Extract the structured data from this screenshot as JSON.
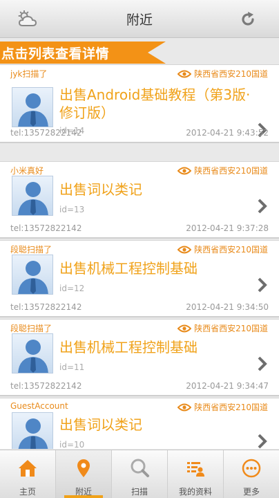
{
  "header": {
    "title": "附近",
    "left_icon": "weather-cloud-icon",
    "right_icon": "refresh-icon"
  },
  "banner": {
    "text": "点击列表查看详情"
  },
  "items": [
    {
      "user": "jyk扫描了",
      "location": "陕西省西安210国道",
      "title": "出售Android基础教程（第3版·修订版）",
      "id": "id=14",
      "tel": "tel:13572822142",
      "time": "2012-04-21 9:43:52"
    },
    {
      "user": "小米真好",
      "location": "陕西省西安210国道",
      "title": "出售词以类记",
      "id": "id=13",
      "tel": "tel:13572822142",
      "time": "2012-04-21 9:37:28"
    },
    {
      "user": "段聪扫描了",
      "location": "陕西省西安210国道",
      "title": "出售机械工程控制基础",
      "id": "id=12",
      "tel": "tel:13572822142",
      "time": "2012-04-21 9:34:50"
    },
    {
      "user": "段聪扫描了",
      "location": "陕西省西安210国道",
      "title": "出售机械工程控制基础",
      "id": "id=11",
      "tel": "tel:13572822142",
      "time": "2012-04-21 9:34:47"
    },
    {
      "user": "GuestAccount",
      "location": "陕西省西安210国道",
      "title": "出售词以类记",
      "id": "id=10",
      "tel": "",
      "time": ""
    }
  ],
  "tabs": [
    {
      "label": "主页",
      "icon": "home-icon",
      "active": false
    },
    {
      "label": "附近",
      "icon": "location-pin-icon",
      "active": true
    },
    {
      "label": "扫描",
      "icon": "magnifier-icon",
      "active": false
    },
    {
      "label": "我的资料",
      "icon": "profile-list-icon",
      "active": false
    },
    {
      "label": "更多",
      "icon": "more-dots-icon",
      "active": false
    }
  ],
  "colors": {
    "accent": "#f0a21a",
    "banner": "#f39216"
  }
}
